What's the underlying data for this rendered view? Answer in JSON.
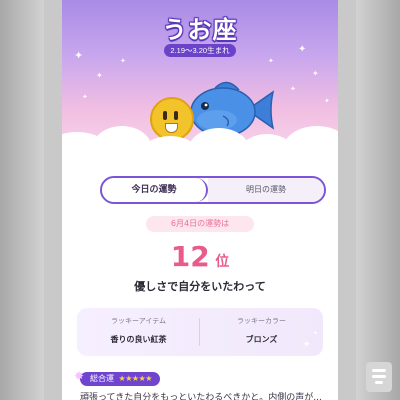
{
  "sign": {
    "title": "うお座",
    "dates": "2.19～3.20生まれ"
  },
  "tabs": [
    {
      "label": "今日の運勢",
      "active": true
    },
    {
      "label": "明日の運勢",
      "active": false
    }
  ],
  "result": {
    "heading": "6月4日の運勢は",
    "rank_number": "12",
    "rank_unit": "位",
    "message": "優しさで自分をいたわって"
  },
  "lucky": {
    "item_label": "ラッキーアイテム",
    "item_value": "香りの良い紅茶",
    "color_label": "ラッキーカラー",
    "color_value": "ブロンズ"
  },
  "overall": {
    "label": "総合運",
    "stars": "★★★★★",
    "text": "頑張ってきた自分をもっといたわるべきかと。内側の声が..."
  },
  "colors": {
    "accent": "#6f45cf",
    "rank": "#e85b8c",
    "hero_top": "#a98be6",
    "hero_bottom": "#f6d6ec"
  }
}
